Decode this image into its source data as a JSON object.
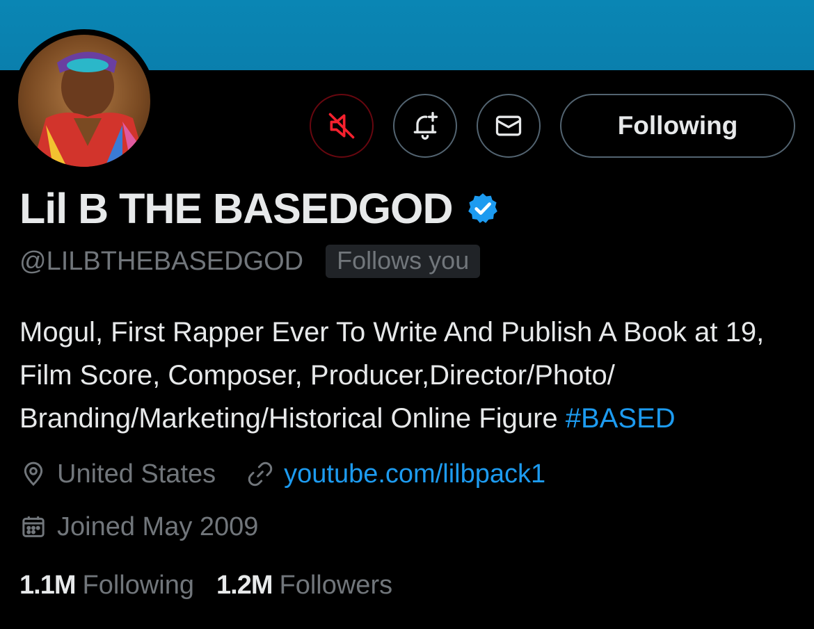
{
  "colors": {
    "banner": "#0a86b4",
    "accent": "#1d9bf0",
    "mute_red": "#f4212e",
    "text_primary": "#e7e9ea",
    "text_secondary": "#71767b"
  },
  "actions": {
    "mute_icon": "muted-speaker-icon",
    "notify_icon": "bell-plus-icon",
    "message_icon": "envelope-icon",
    "following_label": "Following"
  },
  "profile": {
    "display_name": "Lil B THE BASEDGOD",
    "verified_icon": "verified-badge-icon",
    "handle": "@LILBTHEBASEDGOD",
    "follows_you": "Follows you",
    "bio_text": "Mogul, First Rapper Ever To Write And Publish A Book at 19, Film Score, Composer, Producer,Director/Photo/ Branding/Marketing/Historical Online Figure ",
    "bio_hashtag": "#BASED",
    "location": "United States",
    "website": "youtube.com/lilbpack1",
    "joined": "Joined May 2009"
  },
  "stats": {
    "following_count": "1.1M",
    "following_label": "Following",
    "followers_count": "1.2M",
    "followers_label": "Followers"
  }
}
